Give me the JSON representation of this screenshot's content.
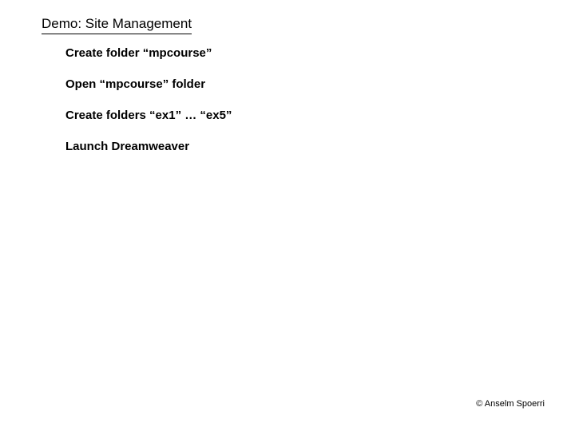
{
  "title": "Demo: Site Management",
  "bullets": [
    "Create folder “mpcourse”",
    "Open “mpcourse” folder",
    "Create folders “ex1” … “ex5”",
    "Launch Dreamweaver"
  ],
  "copyright": "© Anselm Spoerri"
}
